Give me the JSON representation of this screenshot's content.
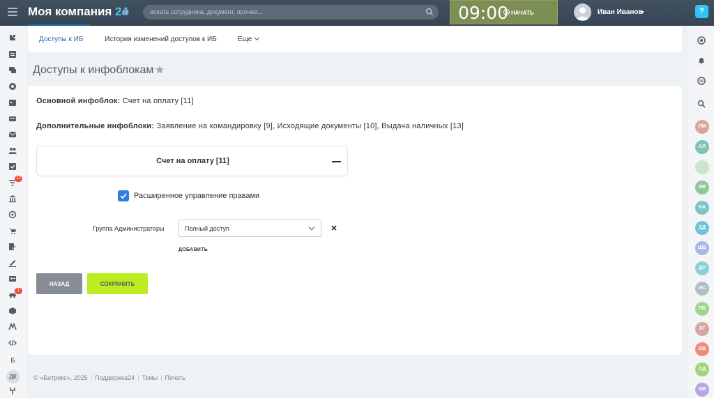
{
  "header": {
    "company_name": "Моя компания",
    "company_number": "24",
    "search_placeholder": "искать сотрудника, документ, прочее...",
    "clock_time": "09:00",
    "start_label": "НАЧАТЬ",
    "user_name": "Иван Иванов",
    "help_label": "?"
  },
  "tabs": [
    {
      "label": "Доступы к ИБ",
      "active": true
    },
    {
      "label": "История изменений доступов к ИБ",
      "active": false
    },
    {
      "label": "Еще",
      "active": false
    }
  ],
  "page": {
    "title": "Доступы к инфоблокам"
  },
  "main": {
    "main_iblock_label": "Основной инфоблок:",
    "main_iblock_value": "Счет на оплату [11]",
    "extra_iblocks_label": "Дополнительные инфоблоки:",
    "extra_iblocks_value": "Заявление на командировку [9], Исходящие документы [10], Выдача наличных [13]",
    "accordion_title": "Счет на оплату [11]",
    "extended_rights_label": "Расширенное управление правами",
    "extended_rights_checked": true,
    "group_label": "Группа Администраторы",
    "access_select_value": "Полный доступ",
    "add_label": "ДОБАВИТЬ",
    "back_button": "НАЗАД",
    "save_button": "СОХРАНИТЬ"
  },
  "left_sidebar": {
    "badges": [
      "12",
      "1"
    ],
    "letter_b": "Б",
    "user_initials": "ДК"
  },
  "right_sidebar": {
    "avatars": [
      {
        "initials": "ЛМ",
        "color": "#d9a59b"
      },
      {
        "initials": "АЛ",
        "color": "#7fc3b3"
      },
      {
        "initials": "",
        "color": "#c8e6c9"
      },
      {
        "initials": "КМ",
        "color": "#8fc79a"
      },
      {
        "initials": "НА",
        "color": "#7ec4c6"
      },
      {
        "initials": "ДД",
        "color": "#71c3d6"
      },
      {
        "initials": "ШБ",
        "color": "#a9b7ea"
      },
      {
        "initials": "ДУ",
        "color": "#8ad0da"
      },
      {
        "initials": "ИС",
        "color": "#b2bcc5"
      },
      {
        "initials": "ЛВ",
        "color": "#a3d391"
      },
      {
        "initials": "ЭГ",
        "color": "#d6a6a1"
      },
      {
        "initials": "ВВ",
        "color": "#f28a7a"
      },
      {
        "initials": "ЛД",
        "color": "#a4d37e"
      },
      {
        "initials": "КМ",
        "color": "#b8a6e4"
      }
    ]
  },
  "footer": {
    "copyright": "© «Битрикс», 2025",
    "support": "Поддержка24",
    "themes": "Темы",
    "print": "Печать"
  },
  "colors": {
    "accent": "#2067b0",
    "save_button": "#bbed21",
    "checkbox": "#2f7ee0",
    "topbar": "#3a4a5a"
  }
}
